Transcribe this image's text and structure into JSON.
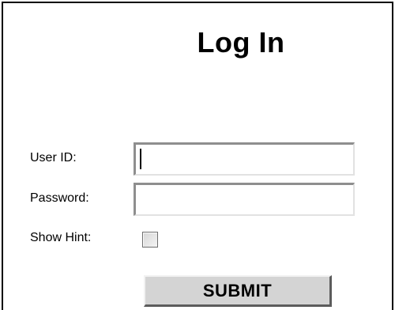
{
  "form": {
    "title": "Log In",
    "user_id_label": "User ID:",
    "user_id_value": "",
    "password_label": "Password:",
    "password_value": "",
    "show_hint_label": "Show Hint:",
    "show_hint_checked": false,
    "submit_label": "SUBMIT"
  }
}
